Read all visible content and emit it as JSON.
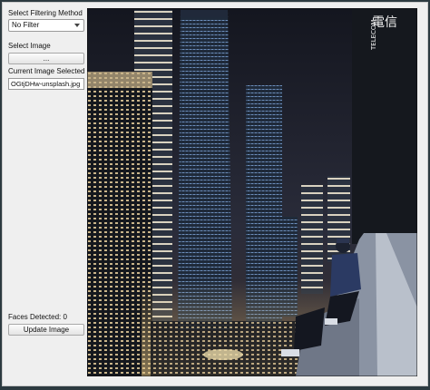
{
  "filter": {
    "label": "Select Filtering Method",
    "selected": "No Filter"
  },
  "image": {
    "label": "Select Image",
    "browse_button": "...",
    "current_label": "Current Image Selected",
    "current_value": "OGtjDHw-unsplash.jpg"
  },
  "faces": {
    "label": "Faces Detected: 0"
  },
  "update_button": "Update Image",
  "photo": {
    "sign_text": "TELECOM",
    "sign_glyphs": "電信",
    "palette": {
      "sky": "#1b1e2b",
      "building_dark": "#15181e",
      "building_lit": "#c9b48a",
      "glass_blue": "#5d7ea8",
      "city_glow": "#e6c480"
    },
    "subject": "person sitting on rooftop ledge"
  }
}
